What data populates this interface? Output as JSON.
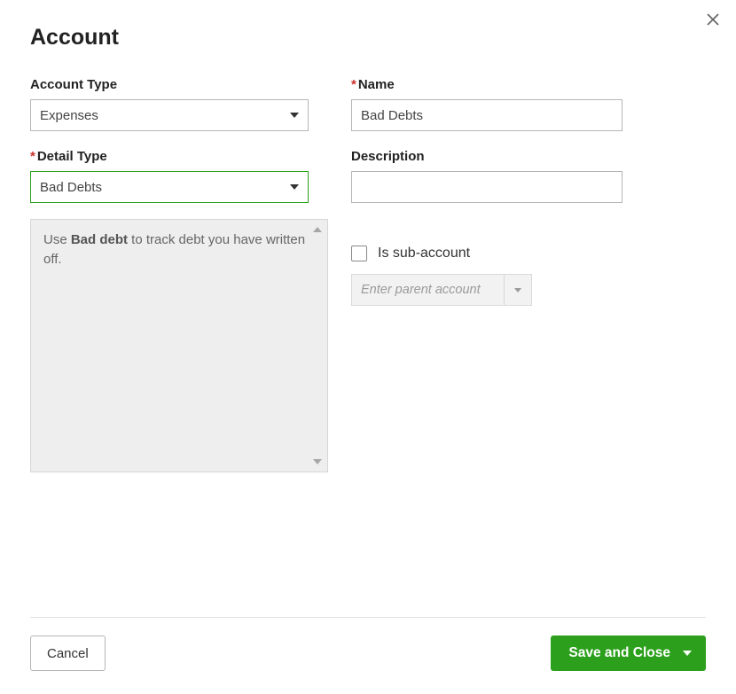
{
  "dialog": {
    "title": "Account"
  },
  "left": {
    "account_type_label": "Account Type",
    "account_type_value": "Expenses",
    "detail_type_label": "Detail Type",
    "detail_type_value": "Bad Debts",
    "info_prefix": "Use ",
    "info_bold": "Bad debt",
    "info_suffix": " to track debt you have written off."
  },
  "right": {
    "name_label": "Name",
    "name_value": "Bad Debts",
    "description_label": "Description",
    "description_value": "",
    "sub_account_label": "Is sub-account",
    "parent_placeholder": "Enter parent account"
  },
  "footer": {
    "cancel_label": "Cancel",
    "save_label": "Save and Close"
  },
  "colors": {
    "primary": "#2ca01c"
  }
}
